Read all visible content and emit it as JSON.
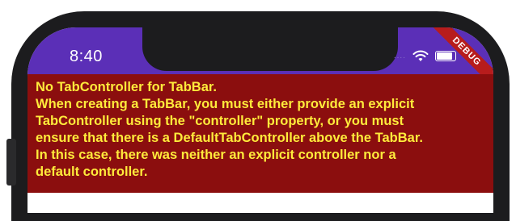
{
  "status_bar": {
    "time": "8:40",
    "signal_dots": "....",
    "icons": [
      "wifi-icon",
      "battery-icon"
    ]
  },
  "debug_banner": {
    "label": "DEBUG"
  },
  "error": {
    "lines": [
      "No TabController for TabBar.",
      "When creating a TabBar, you must either provide an explicit",
      "TabController using the \"controller\" property, or you must",
      "ensure that there is a DefaultTabController above the TabBar.",
      "In this case, there was neither an explicit controller nor a",
      "default controller."
    ]
  },
  "colors": {
    "app_bar": "#5b2fb7",
    "error_background": "#8b0e0e",
    "error_text": "#ffeb3b",
    "debug_banner": "#b71c1c"
  }
}
